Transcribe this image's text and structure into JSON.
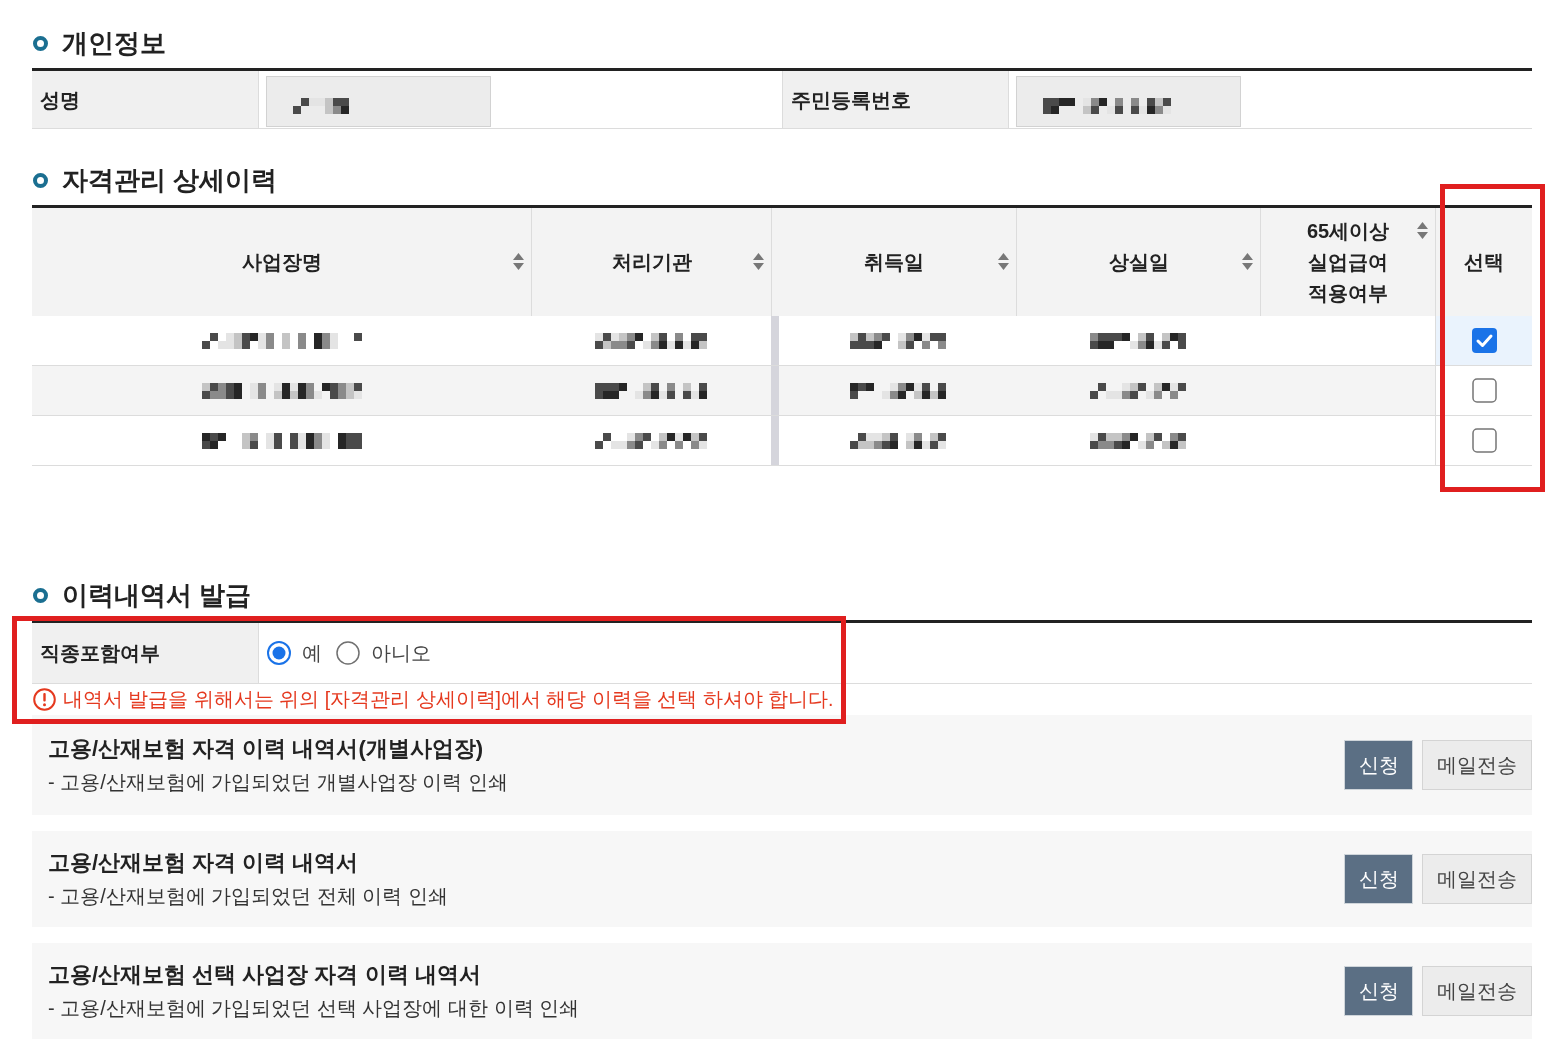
{
  "personal_info": {
    "title": "개인정보",
    "fields": [
      {
        "label": "성명",
        "redacted": true
      },
      {
        "label": "주민등록번호",
        "redacted": true
      }
    ]
  },
  "qualification_history": {
    "title": "자격관리 상세이력",
    "columns": [
      {
        "label": "사업장명",
        "sortable": true,
        "highlighted": false
      },
      {
        "label": "처리기관",
        "sortable": true,
        "highlighted": false
      },
      {
        "label": "취득일",
        "sortable": true,
        "highlighted": false
      },
      {
        "label": "상실일",
        "sortable": true,
        "highlighted": false
      },
      {
        "label": "65세이상 실업급여 적용여부",
        "sortable": true,
        "highlighted": false
      },
      {
        "label": "선택",
        "sortable": false,
        "highlighted": true
      }
    ],
    "rows": [
      {
        "cells": [
          {
            "redacted": true
          },
          {
            "redacted": true
          },
          {
            "redacted": true
          },
          {
            "redacted": true
          },
          {
            "redacted": false
          }
        ],
        "checked": true
      },
      {
        "cells": [
          {
            "redacted": true
          },
          {
            "redacted": true
          },
          {
            "redacted": true
          },
          {
            "redacted": true
          },
          {
            "redacted": false
          }
        ],
        "checked": false
      },
      {
        "cells": [
          {
            "redacted": true
          },
          {
            "redacted": true
          },
          {
            "redacted": true
          },
          {
            "redacted": true
          },
          {
            "redacted": false
          }
        ],
        "checked": false
      }
    ]
  },
  "issuance": {
    "title": "이력내역서 발급",
    "form": {
      "highlighted": true,
      "option": {
        "label": "직종포함여부",
        "choices": [
          {
            "label": "예",
            "selected": true
          },
          {
            "label": "아니오",
            "selected": false
          }
        ]
      },
      "warning": "내역서 발급을 위해서는 위의 [자격관리 상세이력]에서 해당 이력을 선택 하셔야 합니다."
    },
    "documents": [
      {
        "title": "고용/산재보험 자격 이력 내역서(개별사업장)",
        "description": "- 고용/산재보험에 가입되었던 개별사업장 이력 인쇄",
        "buttons": [
          {
            "label": "신청",
            "kind": "primary"
          },
          {
            "label": "메일전송",
            "kind": "secondary"
          }
        ]
      },
      {
        "title": "고용/산재보험 자격 이력 내역서",
        "description": "- 고용/산재보험에 가입되었던 전체 이력 인쇄",
        "buttons": [
          {
            "label": "신청",
            "kind": "primary"
          },
          {
            "label": "메일전송",
            "kind": "secondary"
          }
        ]
      },
      {
        "title": "고용/산재보험 선택 사업장 자격 이력 내역서",
        "description": "- 고용/산재보험에 가입되었던 선택 사업장에 대한 이력 인쇄",
        "buttons": [
          {
            "label": "신청",
            "kind": "primary"
          },
          {
            "label": "메일전송",
            "kind": "secondary"
          }
        ]
      }
    ]
  }
}
